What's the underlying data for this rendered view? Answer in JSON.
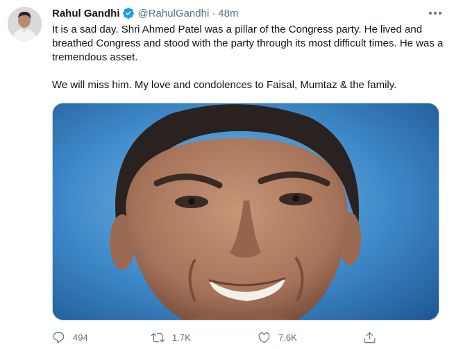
{
  "tweet": {
    "author_name": "Rahul Gandhi",
    "handle": "@RahulGandhi",
    "separator": "·",
    "time": "48m",
    "verified": true,
    "paragraphs": [
      "It is a sad day. Shri Ahmed Patel was a pillar of the Congress party. He lived and breathed Congress and stood with the party through its most difficult times. He was a tremendous asset.",
      "We will miss him. My love and condolences to Faisal, Mumtaz & the family."
    ],
    "media": {
      "description_icon": "photo"
    },
    "actions": {
      "reply_count": "494",
      "retweet_count": "1.7K",
      "like_count": "7.6K"
    }
  },
  "icons": {
    "verified": "verified-badge-icon",
    "more": "more-options-icon",
    "reply": "reply-icon",
    "retweet": "retweet-icon",
    "like": "heart-icon",
    "share": "share-icon"
  },
  "colors": {
    "accent": "#1d9bf0",
    "text": "#0f1419",
    "secondary": "#5b7083",
    "media_background": "#3f8ac9"
  }
}
